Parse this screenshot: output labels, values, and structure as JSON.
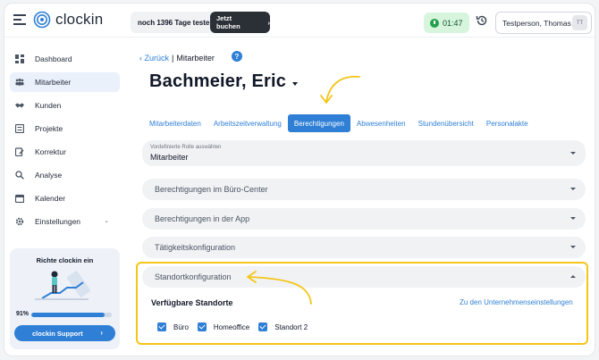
{
  "app": {
    "logo_text": "clockin"
  },
  "topbar": {
    "trial_text": "noch 1396 Tage testen",
    "book_label": "Jetzt buchen",
    "timer": "01:47",
    "user_name": "Testperson, Thomas",
    "user_initials": "TT"
  },
  "sidebar": {
    "items": [
      {
        "label": "Dashboard",
        "icon": "dashboard-icon"
      },
      {
        "label": "Mitarbeiter",
        "icon": "employees-icon",
        "active": true
      },
      {
        "label": "Kunden",
        "icon": "handshake-icon"
      },
      {
        "label": "Projekte",
        "icon": "projects-icon"
      },
      {
        "label": "Korrektur",
        "icon": "correction-icon"
      },
      {
        "label": "Analyse",
        "icon": "analysis-icon"
      },
      {
        "label": "Kalender",
        "icon": "calendar-icon"
      },
      {
        "label": "Einstellungen",
        "icon": "settings-icon"
      }
    ],
    "promo": {
      "title": "Richte clockin ein",
      "percent_label": "91%",
      "progress": 0.91,
      "support_label": "clockin Support"
    }
  },
  "breadcrumb": {
    "back": "Zurück",
    "separator": "|",
    "current": "Mitarbeiter"
  },
  "page": {
    "title": "Bachmeier, Eric"
  },
  "tabs": [
    {
      "label": "Mitarbeiterdaten"
    },
    {
      "label": "Arbeitszeitverwaltung"
    },
    {
      "label": "Berechtigungen",
      "active": true
    },
    {
      "label": "Abwesenheiten"
    },
    {
      "label": "Stundenübersicht"
    },
    {
      "label": "Personalakte"
    }
  ],
  "role": {
    "label": "Vordefinierte Rolle auswählen",
    "value": "Mitarbeiter"
  },
  "accordions": [
    {
      "label": "Berechtigungen im Büro-Center"
    },
    {
      "label": "Berechtigungen in der App"
    },
    {
      "label": "Tätigkeitskonfiguration"
    }
  ],
  "locations": {
    "header": "Standortkonfiguration",
    "title": "Verfügbare Standorte",
    "link": "Zu den Unternehmenseinstellungen",
    "items": [
      {
        "label": "Büro",
        "checked": true
      },
      {
        "label": "Homeoffice",
        "checked": true
      },
      {
        "label": "Standort 2",
        "checked": true
      }
    ]
  },
  "colors": {
    "accent": "#2f7fd6",
    "highlight": "#f5c518",
    "timer_bg": "#d6f5dc"
  }
}
